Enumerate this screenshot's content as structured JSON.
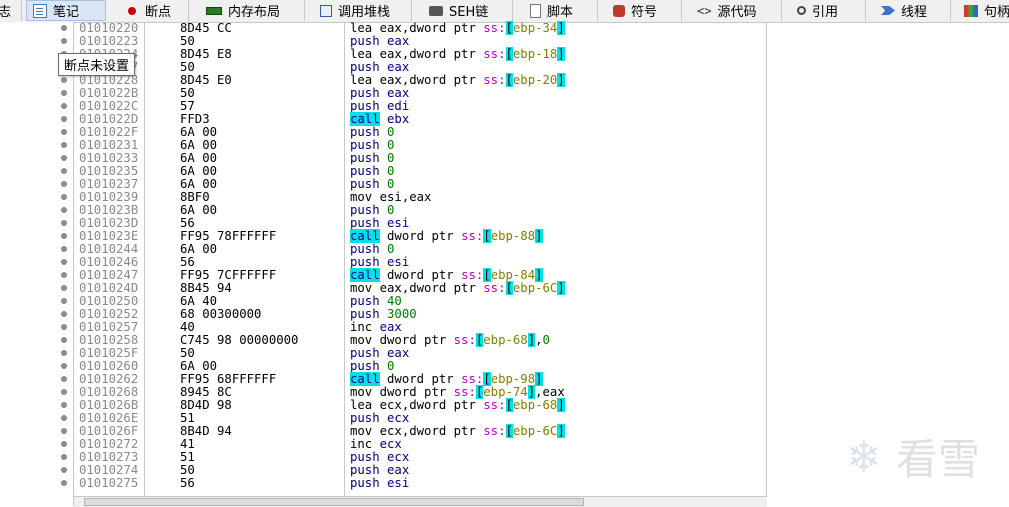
{
  "tabs": [
    {
      "label": "志",
      "icon": "none"
    },
    {
      "label": "笔记",
      "icon": "note-icon",
      "active": true
    },
    {
      "label": "断点",
      "icon": "breakpoint-dot-icon"
    },
    {
      "label": "内存布局",
      "icon": "memory-icon"
    },
    {
      "label": "调用堆栈",
      "icon": "stack-icon"
    },
    {
      "label": "SEH链",
      "icon": "seh-icon"
    },
    {
      "label": "脚本",
      "icon": "script-icon"
    },
    {
      "label": "符号",
      "icon": "symbol-icon"
    },
    {
      "label": "源代码",
      "icon": "source-icon"
    },
    {
      "label": "引用",
      "icon": "search-icon"
    },
    {
      "label": "线程",
      "icon": "thread-icon"
    },
    {
      "label": "句柄",
      "icon": "handle-icon"
    }
  ],
  "source_icon_glyph": "<>",
  "tooltip": "断点未设置",
  "watermark_text": "看雪",
  "colors": {
    "call_highlight": "#00e0e8",
    "segment": "#c000c0",
    "number": "#007a00",
    "register": "#000080"
  },
  "rows": [
    {
      "addr": "01010220",
      "bytes": "8D45 CC",
      "ins": [
        [
          "mov",
          "lea"
        ],
        [
          "op",
          " eax,dword ptr "
        ],
        [
          "seg",
          "ss:"
        ],
        [
          "br",
          "["
        ],
        [
          "mem",
          "ebp-34"
        ],
        [
          "br",
          "]"
        ]
      ]
    },
    {
      "addr": "01010223",
      "bytes": "50",
      "ins": [
        [
          "mn",
          "push"
        ],
        [
          "reg",
          " eax"
        ]
      ]
    },
    {
      "addr": "01010224",
      "bytes": "8D45 E8",
      "ins": [
        [
          "mov",
          "lea"
        ],
        [
          "op",
          " eax,dword ptr "
        ],
        [
          "seg",
          "ss:"
        ],
        [
          "br",
          "["
        ],
        [
          "mem",
          "ebp-18"
        ],
        [
          "br",
          "]"
        ]
      ]
    },
    {
      "addr": "01010227",
      "bytes": "50",
      "ins": [
        [
          "mn",
          "push"
        ],
        [
          "reg",
          " eax"
        ]
      ]
    },
    {
      "addr": "01010228",
      "bytes": "8D45 E0",
      "ins": [
        [
          "mov",
          "lea"
        ],
        [
          "op",
          " eax,dword ptr "
        ],
        [
          "seg",
          "ss:"
        ],
        [
          "br",
          "["
        ],
        [
          "mem",
          "ebp-20"
        ],
        [
          "br",
          "]"
        ]
      ]
    },
    {
      "addr": "0101022B",
      "bytes": "50",
      "ins": [
        [
          "mn",
          "push"
        ],
        [
          "reg",
          " eax"
        ]
      ]
    },
    {
      "addr": "0101022C",
      "bytes": "57",
      "ins": [
        [
          "mn",
          "push"
        ],
        [
          "reg",
          " edi"
        ]
      ]
    },
    {
      "addr": "0101022D",
      "bytes": "FFD3",
      "ins": [
        [
          "call",
          "call"
        ],
        [
          "reg",
          " ebx"
        ]
      ]
    },
    {
      "addr": "0101022F",
      "bytes": "6A 00",
      "ins": [
        [
          "mn",
          "push"
        ],
        [
          "num",
          " 0"
        ]
      ]
    },
    {
      "addr": "01010231",
      "bytes": "6A 00",
      "ins": [
        [
          "mn",
          "push"
        ],
        [
          "num",
          " 0"
        ]
      ]
    },
    {
      "addr": "01010233",
      "bytes": "6A 00",
      "ins": [
        [
          "mn",
          "push"
        ],
        [
          "num",
          " 0"
        ]
      ]
    },
    {
      "addr": "01010235",
      "bytes": "6A 00",
      "ins": [
        [
          "mn",
          "push"
        ],
        [
          "num",
          " 0"
        ]
      ]
    },
    {
      "addr": "01010237",
      "bytes": "6A 00",
      "ins": [
        [
          "mn",
          "push"
        ],
        [
          "num",
          " 0"
        ]
      ]
    },
    {
      "addr": "01010239",
      "bytes": "8BF0",
      "ins": [
        [
          "mov",
          "mov"
        ],
        [
          "op",
          " esi,eax"
        ]
      ]
    },
    {
      "addr": "0101023B",
      "bytes": "6A 00",
      "ins": [
        [
          "mn",
          "push"
        ],
        [
          "num",
          " 0"
        ]
      ]
    },
    {
      "addr": "0101023D",
      "bytes": "56",
      "ins": [
        [
          "mn",
          "push"
        ],
        [
          "reg",
          " esi"
        ]
      ]
    },
    {
      "addr": "0101023E",
      "bytes": "FF95 78FFFFFF",
      "ins": [
        [
          "call",
          "call"
        ],
        [
          "op",
          " dword ptr "
        ],
        [
          "seg",
          "ss:"
        ],
        [
          "br",
          "["
        ],
        [
          "mem",
          "ebp-88"
        ],
        [
          "br",
          "]"
        ]
      ]
    },
    {
      "addr": "01010244",
      "bytes": "6A 00",
      "ins": [
        [
          "mn",
          "push"
        ],
        [
          "num",
          " 0"
        ]
      ]
    },
    {
      "addr": "01010246",
      "bytes": "56",
      "ins": [
        [
          "mn",
          "push"
        ],
        [
          "reg",
          " esi"
        ]
      ]
    },
    {
      "addr": "01010247",
      "bytes": "FF95 7CFFFFFF",
      "ins": [
        [
          "call",
          "call"
        ],
        [
          "op",
          " dword ptr "
        ],
        [
          "seg",
          "ss:"
        ],
        [
          "br",
          "["
        ],
        [
          "mem",
          "ebp-84"
        ],
        [
          "br",
          "]"
        ]
      ]
    },
    {
      "addr": "0101024D",
      "bytes": "8B45 94",
      "ins": [
        [
          "mov",
          "mov"
        ],
        [
          "op",
          " eax,dword ptr "
        ],
        [
          "seg",
          "ss:"
        ],
        [
          "br",
          "["
        ],
        [
          "mem",
          "ebp-6C"
        ],
        [
          "br",
          "]"
        ]
      ]
    },
    {
      "addr": "01010250",
      "bytes": "6A 40",
      "ins": [
        [
          "mn",
          "push"
        ],
        [
          "num",
          " 40"
        ]
      ]
    },
    {
      "addr": "01010252",
      "bytes": "68 00300000",
      "ins": [
        [
          "mn",
          "push"
        ],
        [
          "num",
          " 3000"
        ]
      ]
    },
    {
      "addr": "01010257",
      "bytes": "40",
      "ins": [
        [
          "mov",
          "inc"
        ],
        [
          "reg",
          " eax"
        ]
      ]
    },
    {
      "addr": "01010258",
      "bytes": "C745 98 00000000",
      "ins": [
        [
          "mov",
          "mov"
        ],
        [
          "op",
          " dword ptr "
        ],
        [
          "seg",
          "ss:"
        ],
        [
          "br",
          "["
        ],
        [
          "mem",
          "ebp-68"
        ],
        [
          "br",
          "]"
        ],
        [
          "op",
          ","
        ],
        [
          "num",
          "0"
        ]
      ]
    },
    {
      "addr": "0101025F",
      "bytes": "50",
      "ins": [
        [
          "mn",
          "push"
        ],
        [
          "reg",
          " eax"
        ]
      ]
    },
    {
      "addr": "01010260",
      "bytes": "6A 00",
      "ins": [
        [
          "mn",
          "push"
        ],
        [
          "num",
          " 0"
        ]
      ]
    },
    {
      "addr": "01010262",
      "bytes": "FF95 68FFFFFF",
      "ins": [
        [
          "call",
          "call"
        ],
        [
          "op",
          " dword ptr "
        ],
        [
          "seg",
          "ss:"
        ],
        [
          "br",
          "["
        ],
        [
          "mem",
          "ebp-98"
        ],
        [
          "br",
          "]"
        ]
      ]
    },
    {
      "addr": "01010268",
      "bytes": "8945 8C",
      "ins": [
        [
          "mov",
          "mov"
        ],
        [
          "op",
          " dword ptr "
        ],
        [
          "seg",
          "ss:"
        ],
        [
          "br",
          "["
        ],
        [
          "mem",
          "ebp-74"
        ],
        [
          "br",
          "]"
        ],
        [
          "op",
          ",eax"
        ]
      ]
    },
    {
      "addr": "0101026B",
      "bytes": "8D4D 98",
      "ins": [
        [
          "mov",
          "lea"
        ],
        [
          "op",
          " ecx,dword ptr "
        ],
        [
          "seg",
          "ss:"
        ],
        [
          "br",
          "["
        ],
        [
          "mem",
          "ebp-68"
        ],
        [
          "br",
          "]"
        ]
      ]
    },
    {
      "addr": "0101026E",
      "bytes": "51",
      "ins": [
        [
          "mn",
          "push"
        ],
        [
          "reg",
          " ecx"
        ]
      ]
    },
    {
      "addr": "0101026F",
      "bytes": "8B4D 94",
      "ins": [
        [
          "mov",
          "mov"
        ],
        [
          "op",
          " ecx,dword ptr "
        ],
        [
          "seg",
          "ss:"
        ],
        [
          "br",
          "["
        ],
        [
          "mem",
          "ebp-6C"
        ],
        [
          "br",
          "]"
        ]
      ]
    },
    {
      "addr": "01010272",
      "bytes": "41",
      "ins": [
        [
          "mov",
          "inc"
        ],
        [
          "reg",
          " ecx"
        ]
      ]
    },
    {
      "addr": "01010273",
      "bytes": "51",
      "ins": [
        [
          "mn",
          "push"
        ],
        [
          "reg",
          " ecx"
        ]
      ]
    },
    {
      "addr": "01010274",
      "bytes": "50",
      "ins": [
        [
          "mn",
          "push"
        ],
        [
          "reg",
          " eax"
        ]
      ]
    },
    {
      "addr": "01010275",
      "bytes": "56",
      "ins": [
        [
          "mn",
          "push"
        ],
        [
          "reg",
          " esi"
        ]
      ]
    }
  ]
}
